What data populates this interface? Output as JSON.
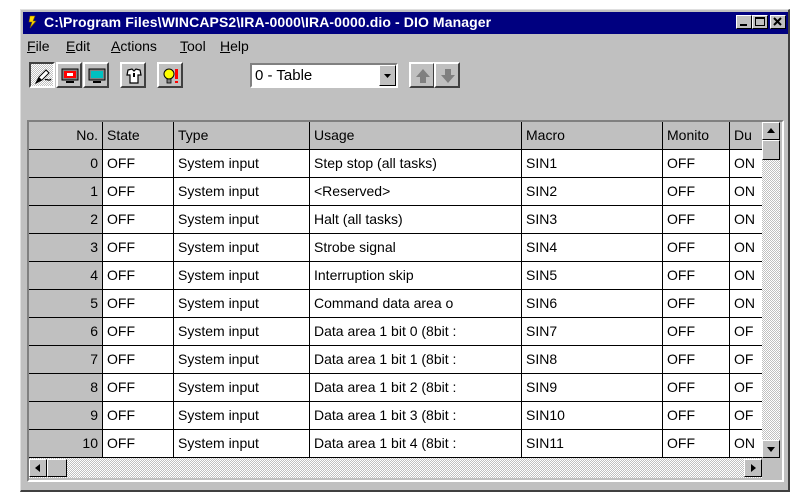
{
  "window": {
    "title": "C:\\Program Files\\WINCAPS2\\IRA-0000\\IRA-0000.dio - DIO Manager",
    "title_bar_color": "#000080"
  },
  "menu": [
    {
      "label": "File",
      "mnemonic": "F",
      "rest": "ile"
    },
    {
      "label": "Edit",
      "mnemonic": "E",
      "rest": "dit"
    },
    {
      "label": "Actions",
      "mnemonic": "A",
      "rest": "ctions"
    },
    {
      "label": "Tool",
      "mnemonic": "T",
      "rest": "ool"
    },
    {
      "label": "Help",
      "mnemonic": "H",
      "rest": "elp"
    }
  ],
  "toolbar": {
    "buttons": [
      {
        "icon": "pen-icon",
        "pressed": true
      },
      {
        "icon": "monitor-red-icon",
        "pressed": false
      },
      {
        "icon": "monitor-green-icon",
        "pressed": false
      },
      {
        "icon": "shirt-icon",
        "pressed": false
      },
      {
        "icon": "bulb-alert-icon",
        "pressed": false
      }
    ],
    "view_select": {
      "value": "0 - Table"
    },
    "nav": [
      {
        "icon": "arrow-up-icon"
      },
      {
        "icon": "arrow-down-icon"
      }
    ]
  },
  "table": {
    "columns": [
      "No.",
      "State",
      "Type",
      "Usage",
      "Macro",
      "Monito",
      "Du"
    ],
    "rows": [
      [
        "0",
        "OFF",
        "System input",
        "Step stop (all tasks)",
        "SIN1",
        "OFF",
        "ON"
      ],
      [
        "1",
        "OFF",
        "System input",
        "<Reserved>",
        "SIN2",
        "OFF",
        "ON"
      ],
      [
        "2",
        "OFF",
        "System input",
        "Halt (all tasks)",
        "SIN3",
        "OFF",
        "ON"
      ],
      [
        "3",
        "OFF",
        "System input",
        "Strobe signal",
        "SIN4",
        "OFF",
        "ON"
      ],
      [
        "4",
        "OFF",
        "System input",
        "Interruption skip",
        "SIN5",
        "OFF",
        "ON"
      ],
      [
        "5",
        "OFF",
        "System input",
        "Command data area o",
        "SIN6",
        "OFF",
        "ON"
      ],
      [
        "6",
        "OFF",
        "System input",
        "Data area 1 bit 0 (8bit :",
        "SIN7",
        "OFF",
        "OF"
      ],
      [
        "7",
        "OFF",
        "System input",
        "Data area 1 bit 1 (8bit :",
        "SIN8",
        "OFF",
        "OF"
      ],
      [
        "8",
        "OFF",
        "System input",
        "Data area 1 bit 2 (8bit :",
        "SIN9",
        "OFF",
        "OF"
      ],
      [
        "9",
        "OFF",
        "System input",
        "Data area 1 bit 3 (8bit :",
        "SIN10",
        "OFF",
        "OF"
      ],
      [
        "10",
        "OFF",
        "System input",
        "Data area 1 bit 4 (8bit :",
        "SIN11",
        "OFF",
        "ON"
      ]
    ]
  }
}
